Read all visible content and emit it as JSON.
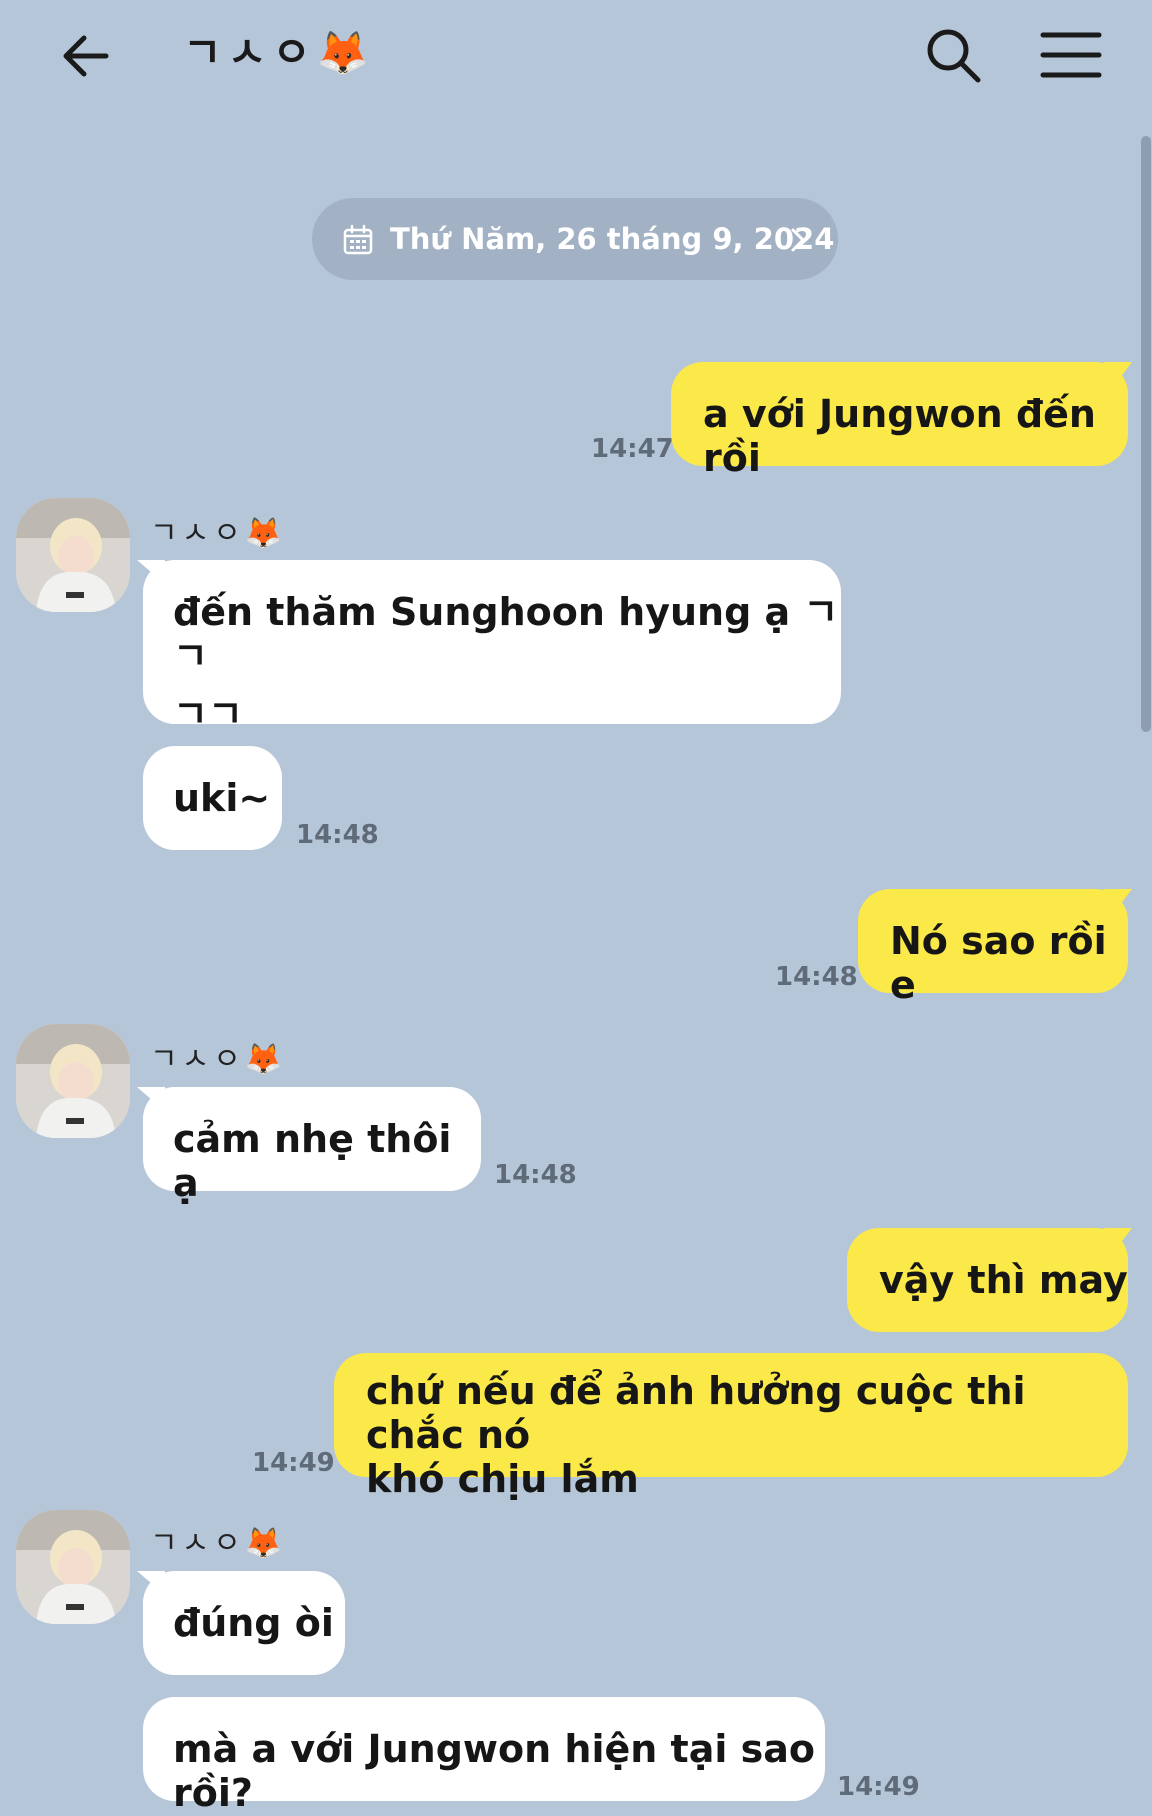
{
  "header": {
    "title": "ㄱㅅㅇ🦊",
    "back_icon": "back-arrow-icon",
    "search_icon": "search-icon",
    "menu_icon": "menu-icon"
  },
  "date_chip": {
    "label": "Thứ Năm, 26 tháng 9, 2024",
    "icon": "calendar-icon"
  },
  "sender_name": "ㄱㅅㅇ🦊",
  "messages": [
    {
      "from": "me",
      "text": "a với Jungwon đến rồi",
      "time": "14:47"
    },
    {
      "from": "them",
      "text_line1": "đến thăm Sunghoon hyung ạ ㄱㄱ",
      "text_line2": "ㄱㄱ"
    },
    {
      "from": "them",
      "text": "uki~",
      "time": "14:48"
    },
    {
      "from": "me",
      "text": "Nó sao rồi e",
      "time": "14:48"
    },
    {
      "from": "them",
      "text": "cảm nhẹ thôi ạ",
      "time": "14:48"
    },
    {
      "from": "me",
      "text": "vậy thì may"
    },
    {
      "from": "me",
      "text_line1": "chứ nếu để ảnh hưởng cuộc thi chắc nó",
      "text_line2": "khó chịu lắm",
      "time": "14:49"
    },
    {
      "from": "them",
      "text": "đúng òi"
    },
    {
      "from": "them",
      "text": "mà a với Jungwon hiện tại sao rồi?",
      "time": "14:49"
    }
  ],
  "colors": {
    "background": "#b6c6d9",
    "my_bubble": "#fbe849",
    "their_bubble": "#ffffff",
    "timestamp": "#5f6b79"
  }
}
